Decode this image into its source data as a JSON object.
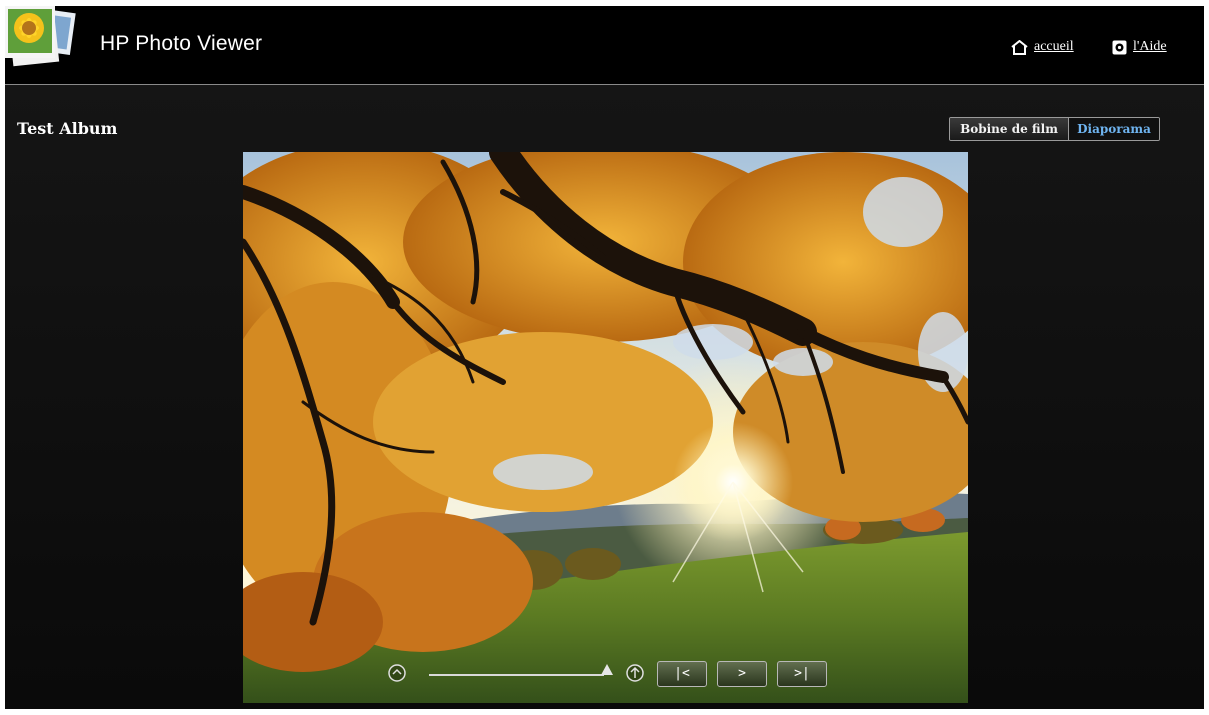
{
  "header": {
    "app_title": "HP Photo Viewer",
    "home_link": "accueil",
    "help_link": "l'Aide",
    "home_icon": "home-icon",
    "help_icon": "help-icon",
    "logo_icon": "sunflower-photo-stack-logo"
  },
  "album": {
    "title": "Test Album"
  },
  "view_toggle": {
    "film_label": "Bobine de film",
    "slideshow_label": "Diaporama",
    "selected": "Diaporama"
  },
  "photo": {
    "subject": "autumn tree over meadow with setting sun"
  },
  "controls": {
    "zoom_out_icon": "zoom-out-icon",
    "zoom_in_icon": "zoom-in-icon",
    "zoom_level_fraction": 1.0,
    "first_label": "|<",
    "play_label": ">",
    "last_label": ">|"
  },
  "colors": {
    "background": "#0b0b0b",
    "header": "#000000",
    "accent_selected": "#6fb4f0",
    "text": "#ffffff"
  }
}
